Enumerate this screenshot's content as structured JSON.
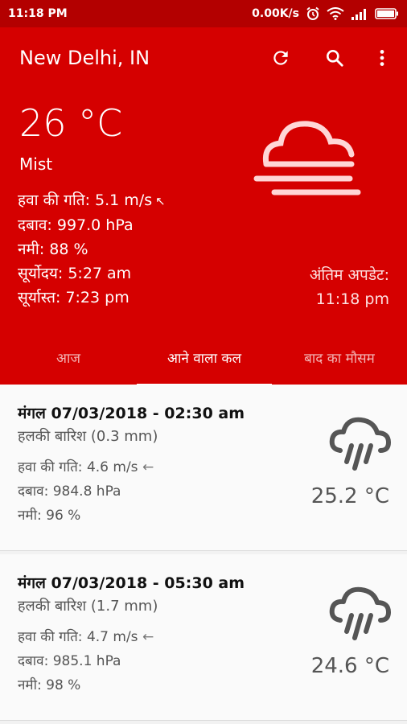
{
  "status_bar": {
    "time": "11:18 PM",
    "network_speed": "0.00K/s"
  },
  "header": {
    "city": "New Delhi, IN",
    "temperature": "26 °C",
    "description": "Mist",
    "wind": "हवा की गति: 5.1 m/s",
    "wind_arrow": "↖",
    "pressure": "दबाव: 997.0 hPa",
    "humidity": "नमी: 88 %",
    "sunrise": "सूर्योदय: 5:27 am",
    "sunset": "सूर्यास्त: 7:23 pm",
    "last_update_label": "अंतिम अपडेट:",
    "last_update_time": "11:18 pm",
    "icons": {
      "refresh": "refresh-icon",
      "search": "search-icon",
      "menu": "more-vert-icon",
      "weather": "mist-icon"
    }
  },
  "tabs": [
    {
      "label": "आज",
      "active": false
    },
    {
      "label": "आने वाला कल",
      "active": true
    },
    {
      "label": "बाद का मौसम",
      "active": false
    }
  ],
  "forecasts": [
    {
      "date": "मंगल 07/03/2018 - 02:30 am",
      "condition": "हलकी बारिश (0.3 mm)",
      "wind": "हवा की गति: 4.6 m/s",
      "wind_arrow": "←",
      "pressure": "दबाव: 984.8 hPa",
      "humidity": "नमी: 96 %",
      "temperature": "25.2 °C",
      "icon": "rain-icon"
    },
    {
      "date": "मंगल 07/03/2018 - 05:30 am",
      "condition": "हलकी बारिश (1.7 mm)",
      "wind": "हवा की गति: 4.7 m/s",
      "wind_arrow": "←",
      "pressure": "दबाव: 985.1 hPa",
      "humidity": "नमी: 98 %",
      "temperature": "24.6 °C",
      "icon": "rain-icon"
    }
  ],
  "colors": {
    "primary": "#d50000",
    "status_bar": "#b30000",
    "card_background": "#fafafa"
  }
}
